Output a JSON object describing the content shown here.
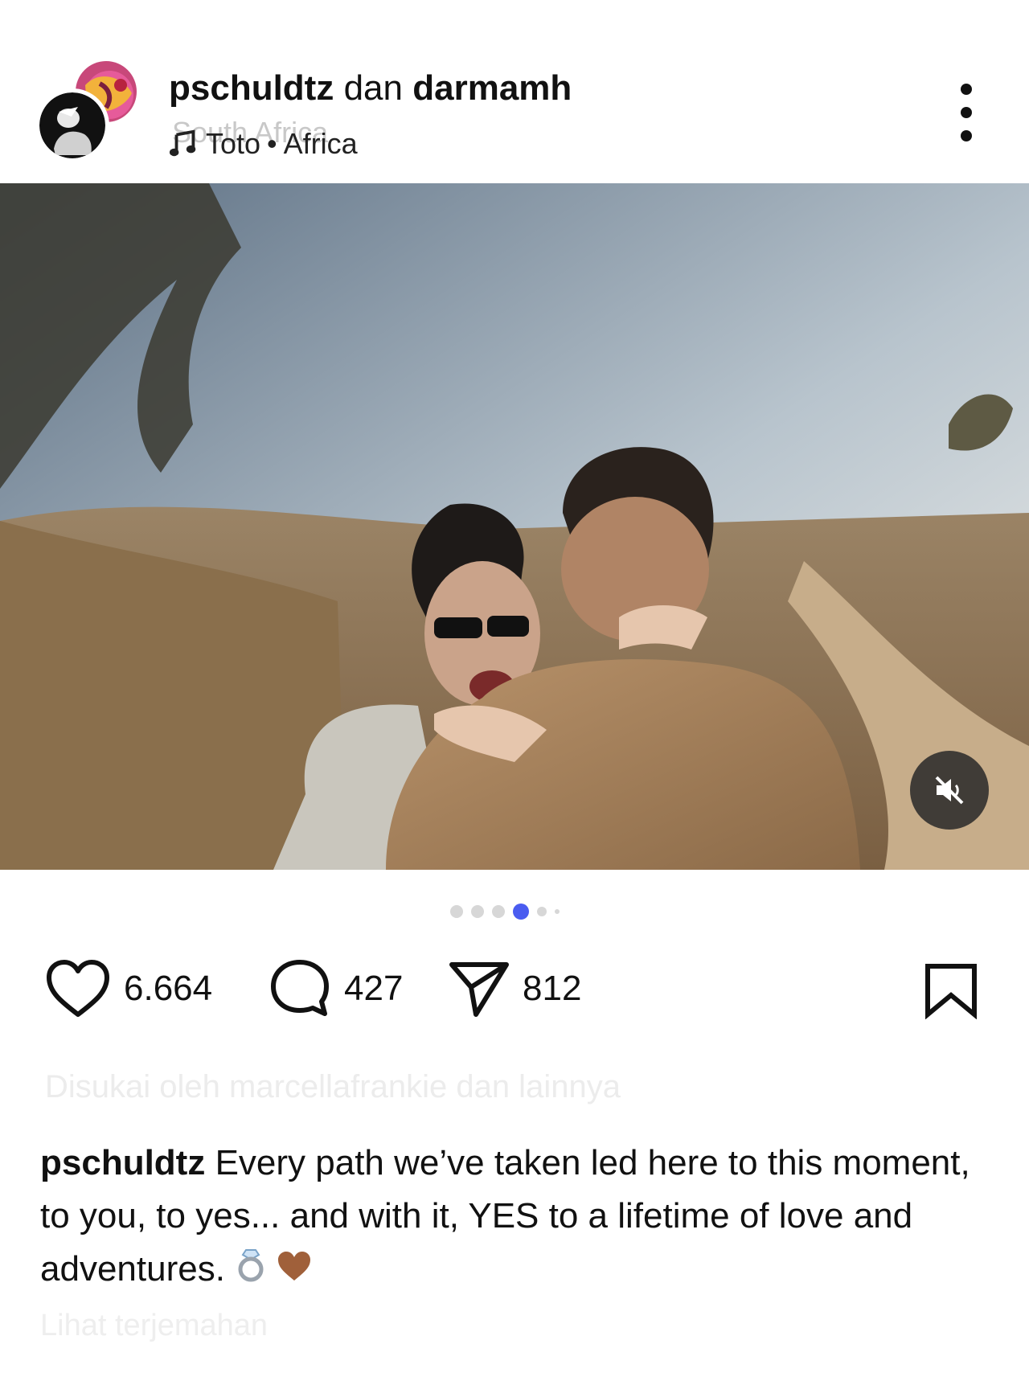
{
  "post_header": {
    "username_primary": "pschuldtz",
    "conjunction": "dan",
    "username_secondary": "darmamh",
    "location": "South Africa",
    "music_artist": "Toto",
    "music_separator": "•",
    "music_title": "Africa"
  },
  "carousel": {
    "page_count": 6,
    "active_index": 3
  },
  "actions": {
    "likes": "6.664",
    "comments": "427",
    "shares": "812"
  },
  "comment_preview": "Disukai oleh marcellafrankie dan lainnya",
  "caption": {
    "username": "pschuldtz",
    "text": "Every path we’ve taken led here to this moment, to you, to yes... and with it, YES to a lifetime of love and adventures."
  },
  "see_translation": "Lihat terjemahan",
  "icons": {
    "more": "more-vertical-icon",
    "music": "music-note-icon",
    "mute": "speaker-muted-icon",
    "like": "heart-outline-icon",
    "comment": "comment-bubble-icon",
    "share": "send-icon",
    "save": "bookmark-icon"
  },
  "colors": {
    "active_dot": "#4a5cf0",
    "inactive_dot": "#d7d7d7",
    "text": "#111111"
  }
}
